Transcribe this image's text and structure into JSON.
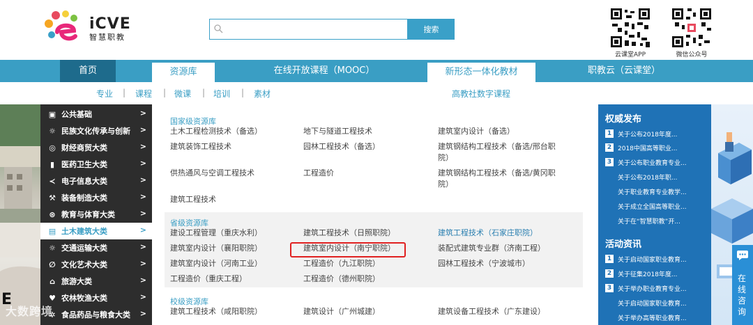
{
  "brand": {
    "logo_en": "iCVE",
    "logo_cn": "智慧职教"
  },
  "search": {
    "placeholder": "",
    "value": "",
    "button": "搜索"
  },
  "qr_codes": [
    {
      "label": "云课堂APP"
    },
    {
      "label": "微信公众号"
    }
  ],
  "nav": {
    "home": "首页",
    "resource_lib": "资源库",
    "mooc": "在线开放课程（MOOC）",
    "new_textbook": "新形态一体化教材",
    "cloud_class": "职教云（云课堂）"
  },
  "subnav": {
    "items": [
      "专业",
      "课程",
      "微课",
      "培训",
      "素材"
    ],
    "sep": "|",
    "right": "高教社数字课程"
  },
  "categories": [
    {
      "label": "公共基础",
      "icon": "book-icon"
    },
    {
      "label": "民族文化传承与创新",
      "icon": "lamp-icon"
    },
    {
      "label": "财经商贸大类",
      "icon": "coin-icon"
    },
    {
      "label": "医药卫生大类",
      "icon": "bottle-icon"
    },
    {
      "label": "电子信息大类",
      "icon": "share-icon"
    },
    {
      "label": "装备制造大类",
      "icon": "wrench-icon"
    },
    {
      "label": "教育与体育大类",
      "icon": "ball-icon"
    },
    {
      "label": "土木建筑大类",
      "icon": "building-icon"
    },
    {
      "label": "交通运输大类",
      "icon": "bulb-icon"
    },
    {
      "label": "文化艺术大类",
      "icon": "leaf-icon"
    },
    {
      "label": "旅游大类",
      "icon": "hat-icon"
    },
    {
      "label": "农林牧渔大类",
      "icon": "plant-icon"
    },
    {
      "label": "食品药品与粮食大类",
      "icon": "grain-icon"
    }
  ],
  "category_arrow": ">",
  "sections": {
    "national": {
      "title": "国家级资源库",
      "courses": [
        "土木工程检测技术（备选）",
        "地下与隧道工程技术",
        "建筑室内设计（备选）",
        "建筑装饰工程技术",
        "园林工程技术（备选）",
        "建筑钢结构工程技术（备选/邢台职院）",
        "供热通风与空调工程技术",
        "工程造价",
        "建筑钢结构工程技术（备选/黄冈职院）",
        "建筑工程技术"
      ]
    },
    "provincial": {
      "title": "省级资源库",
      "courses": [
        "建设工程管理（重庆水利）",
        "建筑工程技术（日照职院）",
        "建筑工程技术（石家庄职院）",
        "建筑室内设计（襄阳职院）",
        "建筑室内设计（南宁职院）",
        "装配式建筑专业群（济南工程）",
        "建筑室内设计（河南工业）",
        "工程造价（九江职院）",
        "园林工程技术（宁波城市）",
        "工程造价（重庆工程）",
        "工程造价（德州职院）"
      ]
    },
    "school": {
      "title": "校级资源库",
      "courses": [
        "建筑工程技术（咸阳职院）",
        "建筑设计（广州城建）",
        "建筑设备工程技术（广东建设）"
      ]
    }
  },
  "side": {
    "authority": {
      "title": "权威发布",
      "items": [
        {
          "num": "1",
          "text": "关于公布2018年度..."
        },
        {
          "num": "2",
          "text": "2018中国高等职业..."
        },
        {
          "num": "3",
          "text": "关于公布职业教育专业..."
        },
        {
          "num": "",
          "text": "关于公布2018年职..."
        },
        {
          "num": "",
          "text": "关于职业教育专业教学..."
        },
        {
          "num": "",
          "text": "关于成立全国高等职业..."
        },
        {
          "num": "",
          "text": "关于在“智慧职教”开..."
        }
      ]
    },
    "activity": {
      "title": "活动资讯",
      "items": [
        {
          "num": "1",
          "text": "关于启动国家职业教育..."
        },
        {
          "num": "2",
          "text": "关于征集2018年度..."
        },
        {
          "num": "3",
          "text": "关于举办职业教育专业..."
        },
        {
          "num": "",
          "text": "关于启动国家职业教育..."
        },
        {
          "num": "",
          "text": "关于举办高等职业教育..."
        }
      ]
    }
  },
  "consult": {
    "text": "在线咨询"
  },
  "watermark": "大数跨境",
  "colors": {
    "primary": "#3a9ec4",
    "dark_nav": "#1e6b8c",
    "menu_bg": "#2d2d2d",
    "side_bg": "#1f72b6",
    "highlight": "#e02020"
  }
}
